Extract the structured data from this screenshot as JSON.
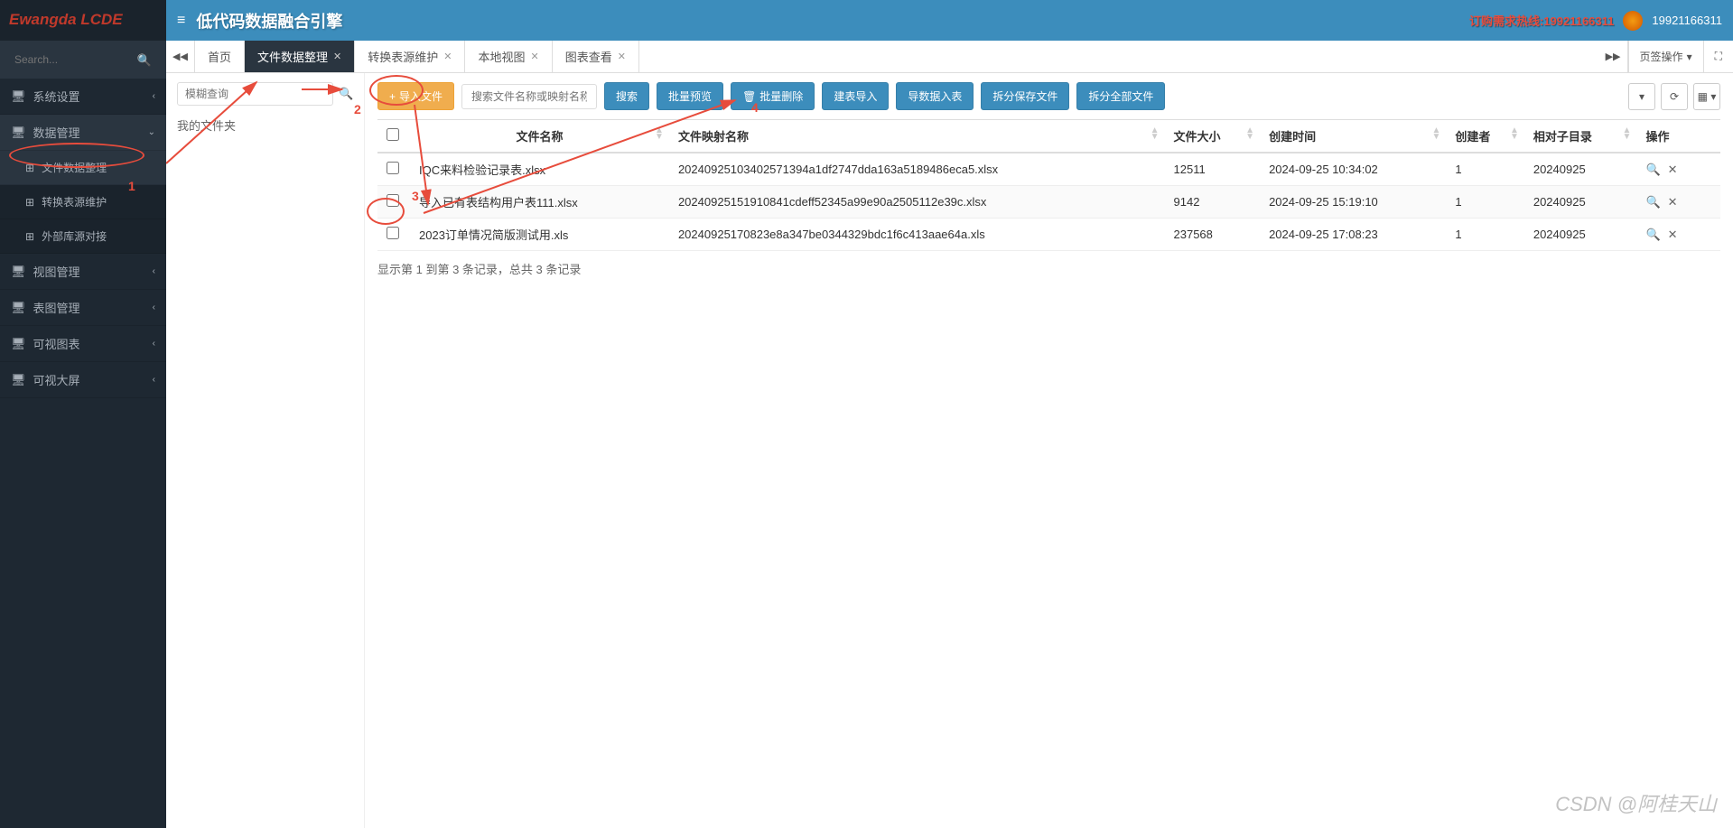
{
  "logo": "Ewangda LCDE",
  "search": {
    "placeholder": "Search..."
  },
  "nav": [
    {
      "icon": "🖥",
      "label": "系统设置",
      "chev": "‹"
    },
    {
      "icon": "🖥",
      "label": "数据管理",
      "chev": "⌄",
      "open": true,
      "sub": [
        {
          "icon": "⊞",
          "label": "文件数据整理",
          "active": true
        },
        {
          "icon": "⊞",
          "label": "转换表源维护"
        },
        {
          "icon": "⊞",
          "label": "外部库源对接"
        }
      ]
    },
    {
      "icon": "🖥",
      "label": "视图管理",
      "chev": "‹"
    },
    {
      "icon": "🖥",
      "label": "表图管理",
      "chev": "‹"
    },
    {
      "icon": "🖥",
      "label": "可视图表",
      "chev": "‹"
    },
    {
      "icon": "🖥",
      "label": "可视大屏",
      "chev": "‹"
    }
  ],
  "topbar": {
    "title": "低代码数据融合引擎",
    "hotline": "订购需求热线:19921166311",
    "user": "19921166311"
  },
  "tabs": [
    {
      "label": "首页",
      "closable": false
    },
    {
      "label": "文件数据整理",
      "closable": true,
      "active": true
    },
    {
      "label": "转换表源维护",
      "closable": true
    },
    {
      "label": "本地视图",
      "closable": true
    },
    {
      "label": "图表查看",
      "closable": true
    }
  ],
  "tabops": {
    "label": "页签操作"
  },
  "leftpanel": {
    "filter_ph": "模糊查询",
    "folder": "我的文件夹"
  },
  "toolbar": {
    "import": "导入文件",
    "search_ph": "搜索文件名称或映射名称",
    "search": "搜索",
    "batch_preview": "批量预览",
    "batch_delete": "批量删除",
    "build_import": "建表导入",
    "import_table": "导数据入表",
    "split_save": "拆分保存文件",
    "split_all": "拆分全部文件"
  },
  "table": {
    "headers": [
      "文件名称",
      "文件映射名称",
      "文件大小",
      "创建时间",
      "创建者",
      "相对子目录",
      "操作"
    ],
    "rows": [
      {
        "name": "IQC来料检验记录表.xlsx",
        "map": "20240925103402571394a1df2747dda163a5189486eca5.xlsx",
        "size": "12511",
        "time": "2024-09-25 10:34:02",
        "creator": "1",
        "dir": "20240925"
      },
      {
        "name": "导入已有表结构用户表111.xlsx",
        "map": "20240925151910841cdeff52345a99e90a2505112e39c.xlsx",
        "size": "9142",
        "time": "2024-09-25 15:19:10",
        "creator": "1",
        "dir": "20240925"
      },
      {
        "name": "2023订单情况简版测试用.xls",
        "map": "20240925170823e8a347be0344329bdc1f6c413aae64a.xls",
        "size": "237568",
        "time": "2024-09-25 17:08:23",
        "creator": "1",
        "dir": "20240925"
      }
    ],
    "info": "显示第 1 到第 3 条记录，总共 3 条记录"
  },
  "annotations": {
    "n1": "1",
    "n2": "2",
    "n3": "3",
    "n4": "4"
  },
  "watermark": "CSDN @阿桂天山"
}
